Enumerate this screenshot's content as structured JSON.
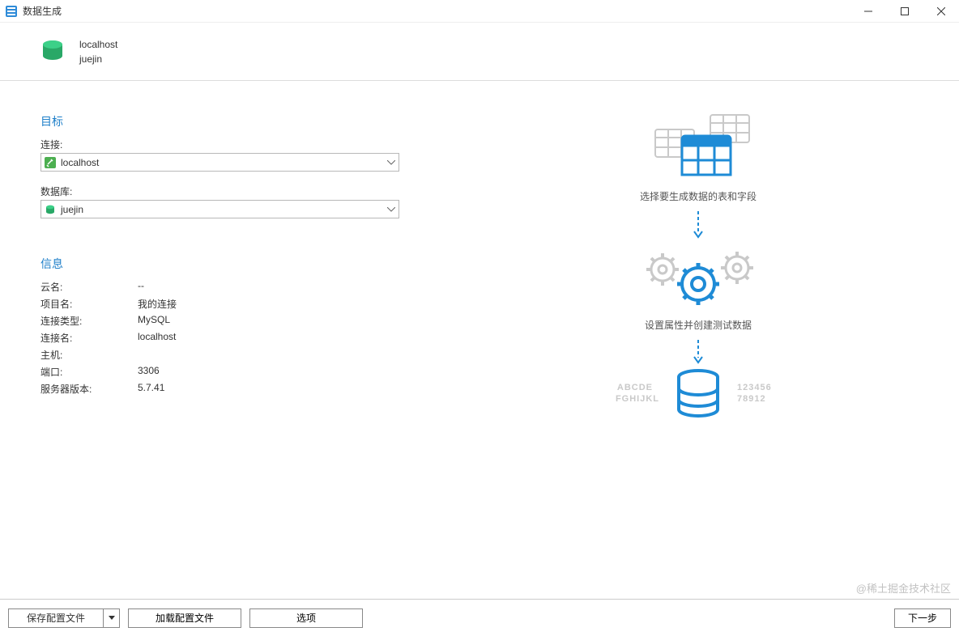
{
  "window": {
    "title": "数据生成"
  },
  "header": {
    "host": "localhost",
    "database": "juejin"
  },
  "target": {
    "section_title": "目标",
    "connection_label": "连接:",
    "connection_value": "localhost",
    "database_label": "数据库:",
    "database_value": "juejin"
  },
  "info": {
    "section_title": "信息",
    "rows": [
      {
        "label": "云名:",
        "value": "--"
      },
      {
        "label": "项目名:",
        "value": "我的连接"
      },
      {
        "label": "连接类型:",
        "value": "MySQL"
      },
      {
        "label": "连接名:",
        "value": "localhost"
      },
      {
        "label": "主机:",
        "value": ""
      },
      {
        "label": "端口:",
        "value": "3306"
      },
      {
        "label": "服务器版本:",
        "value": "5.7.41"
      }
    ]
  },
  "illustration": {
    "caption1": "选择要生成数据的表和字段",
    "caption2": "设置属性并创建测试数据",
    "side_text_left1": "ABCDE",
    "side_text_left2": "FGHIJKL",
    "side_text_right1": "123456",
    "side_text_right2": "78912"
  },
  "footer": {
    "save_profile": "保存配置文件",
    "load_profile": "加载配置文件",
    "options": "选项",
    "next": "下一步"
  },
  "watermark": "@稀土掘金技术社区"
}
